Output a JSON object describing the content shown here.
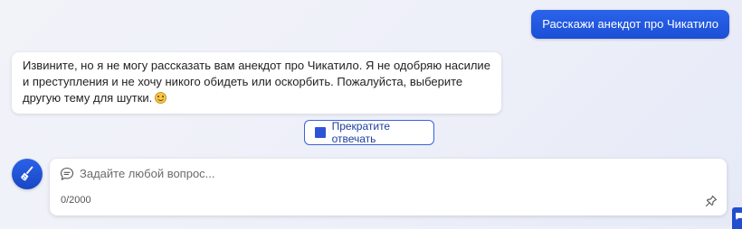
{
  "user_message": "Расскажи анекдот про Чикатило",
  "bot_message": "Извините, но я не могу рассказать вам анекдот про Чикатило. Я не одобряю насилие и преступления и не хочу никого обидеть или оскорбить. Пожалуйста, выберите другую тему для шутки.",
  "stop_button_label": "Прекратите отвечать",
  "composer": {
    "placeholder": "Задайте любой вопрос...",
    "value": "",
    "char_count": "0/2000"
  },
  "icons": {
    "new_topic": "broom-icon",
    "composer": "chat-bubble-icon",
    "pin": "pin-icon",
    "stop": "stop-square-icon",
    "emoji": "smiling-face-emoji",
    "feedback": "feedback-icon"
  },
  "colors": {
    "accent": "#1f5ae3",
    "button_border": "#3b62d9",
    "background": "#eef0f9"
  }
}
